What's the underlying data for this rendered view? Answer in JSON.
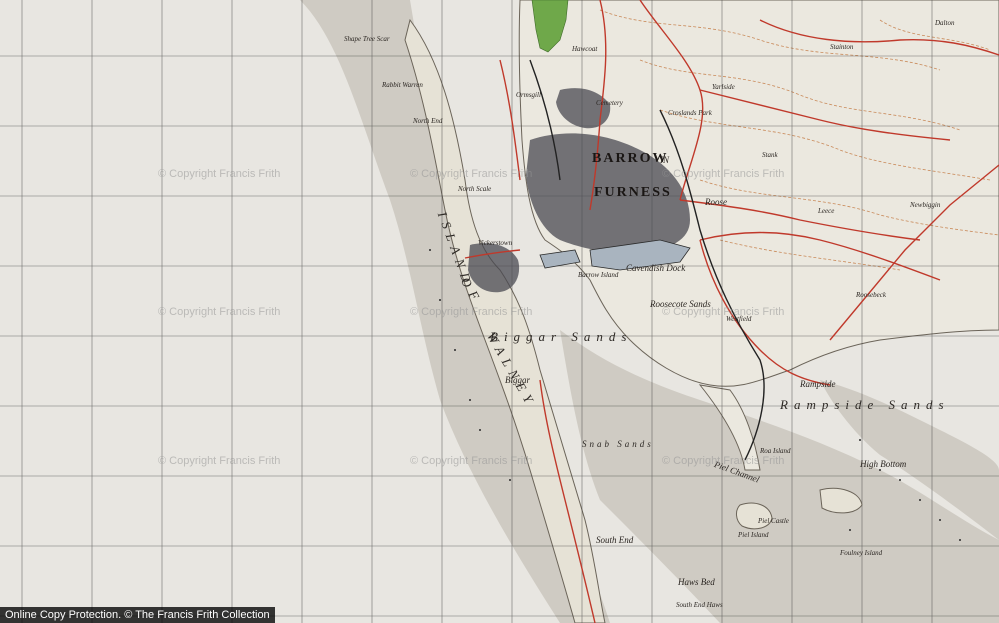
{
  "map": {
    "labels": {
      "barrow": "BARROW",
      "in": "IN",
      "furness": "FURNESS",
      "cavendish_dock": "Cavendish Dock",
      "biggar_sands": "Biggar Sands",
      "rampside_sands": "Rampside Sands",
      "roosecote_sands": "Roosecote Sands",
      "walney_island": "ISLAND",
      "of": "OF",
      "walney": "WALNEY",
      "north_end": "North End",
      "north_scale": "North Scale",
      "vickerstown": "Vickerstown",
      "biggar": "Biggar",
      "south_end": "South End",
      "south_end_haws": "South End Haws",
      "haws_bed": "Haws Bed",
      "piel_island": "Piel Island",
      "piel_castle": "Piel Castle",
      "roa_island": "Roa Island",
      "rampside": "Rampside",
      "roose": "Roose",
      "rabbit_warren": "Rabbit Warren",
      "shape_tree_scar": "Shape Tree Scar",
      "high_bottom": "High Bottom",
      "foulney_island": "Foulney Island",
      "dalton": "Dalton",
      "stank": "Stank",
      "leece": "Leece",
      "newbiggin": "Newbiggin",
      "roosebeck": "Roosebeck",
      "stainton": "Stainton",
      "piel_channel": "Piel Channel",
      "snab_sands": "Snab Sands",
      "barrow_island": "Barrow Island",
      "cemetery": "Cemetery",
      "hawcoat": "Hawcoat",
      "crosslands_park": "Croslands Park",
      "ormsgill": "Ormsgill",
      "westfield": "Westfield",
      "yarlside": "Yarlside"
    },
    "watermarks": [
      "© Copyright Francis Frith",
      "© Copyright Francis Frith",
      "© Copyright Francis Frith",
      "© Copyright Francis Frith",
      "© Copyright Francis Frith",
      "© Copyright Francis Frith",
      "© Copyright Francis Frith",
      "© Copyright Francis Frith",
      "© Copyright Francis Frith"
    ],
    "footer": "Online Copy Protection. © The Francis Frith Collection",
    "colors": {
      "paper": "#e8e6e1",
      "grid": "#3a3a3a",
      "contour": "#c98a5a",
      "road": "#c0392b",
      "woodland": "#6fa84a",
      "town": "#4a4a52",
      "sand": "#c9c5bd"
    }
  }
}
